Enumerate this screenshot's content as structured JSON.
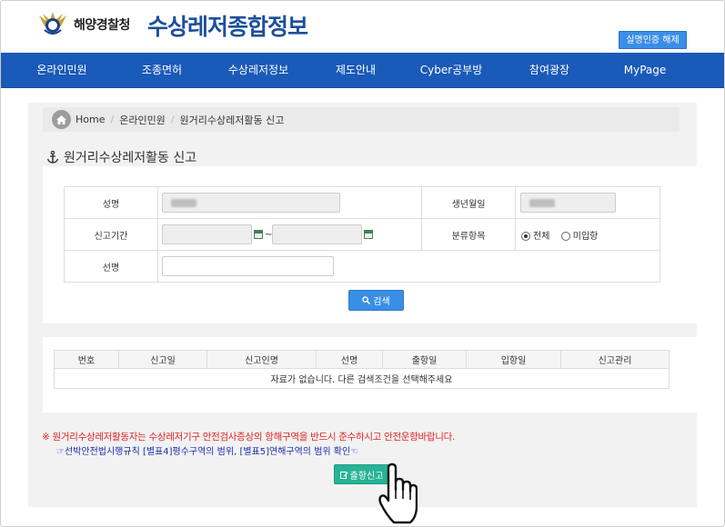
{
  "header": {
    "agency": "해양경찰청",
    "site_title": "수상레저종합정보",
    "cert_button": "실명인증 해제"
  },
  "nav": {
    "items": [
      "온라인민원",
      "조종면허",
      "수상레저정보",
      "제도안내",
      "Cyber공부방",
      "참여광장",
      "MyPage"
    ]
  },
  "breadcrumb": {
    "home": "Home",
    "level1": "온라인민원",
    "level2": "원거리수상레저활동 신고"
  },
  "page_title": "원거리수상레저활동 신고",
  "search": {
    "name_label": "성명",
    "birth_label": "생년월일",
    "period_label": "신고기간",
    "period_sep": "~",
    "category_label": "분류항목",
    "radio_all": "전체",
    "radio_not_entered": "미입항",
    "ship_label": "선명",
    "search_button": "검색"
  },
  "results": {
    "columns": [
      "번호",
      "신고일",
      "신고인명",
      "선명",
      "출항일",
      "입항일",
      "신고관리"
    ],
    "empty_message": "자료가 없습니다. 다른 검색조건을 선택해주세요"
  },
  "notice": "※ 원거리수상레저활동자는 수상레저기구 안전검사증상의 항해구역을 반드시 준수하시고 안전운항바랍니다.",
  "link": "☞선박안전법시행규칙 [별표4]평수구역의 범위, [별표5]연해구역의 범위 확인☜",
  "report_button": "출항신고",
  "colors": {
    "nav_bg": "#1a5ab8",
    "title_blue": "#1d4f9b",
    "button_blue": "#3a8ee6",
    "report_green": "#27b395",
    "notice_red": "#e02424"
  }
}
